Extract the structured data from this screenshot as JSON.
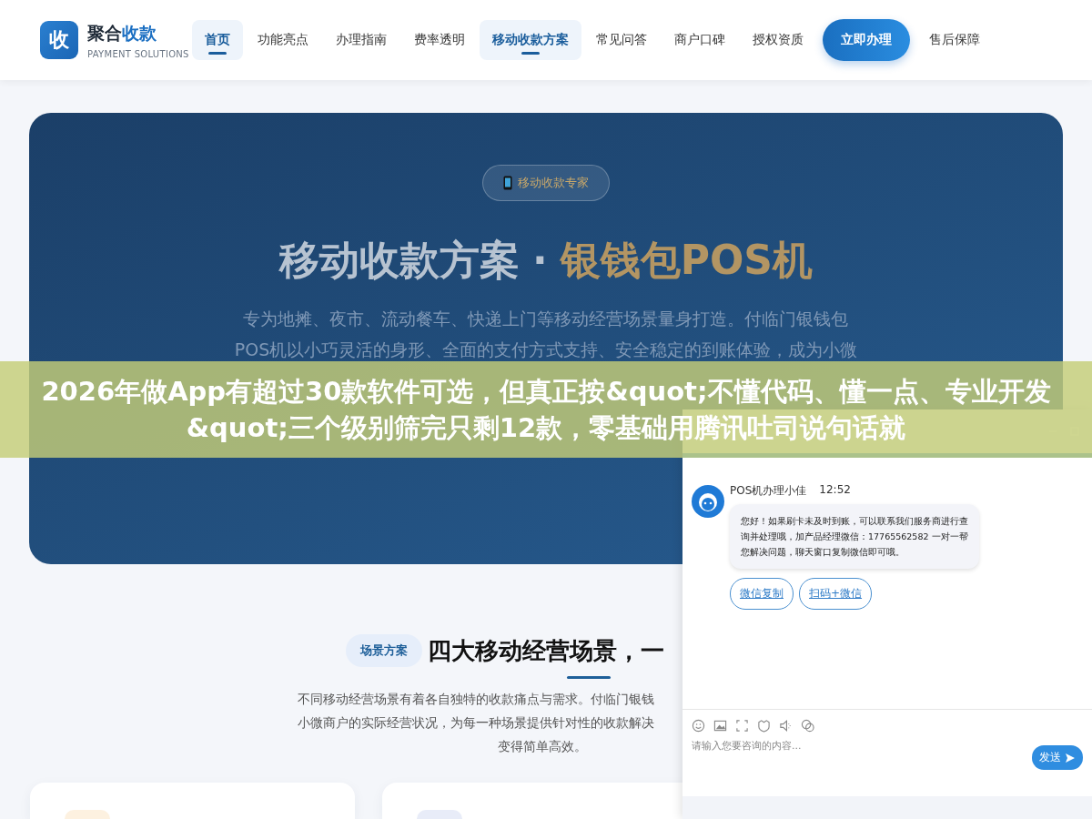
{
  "header": {
    "logo": "收",
    "brand": {
      "name": "聚合",
      "accent": "收款",
      "sub": "PAYMENT SOLUTIONS"
    },
    "nav": [
      {
        "label": "首页",
        "kind": "link",
        "selected": true
      },
      {
        "label": "功能亮点",
        "kind": "link",
        "selected": false
      },
      {
        "label": "办理指南",
        "kind": "link",
        "selected": false
      },
      {
        "label": "费率透明",
        "kind": "link",
        "selected": false
      },
      {
        "label": "移动收款方案",
        "kind": "link",
        "selected": true
      },
      {
        "label": "常见问答",
        "kind": "link",
        "selected": false
      },
      {
        "label": "商户口碑",
        "kind": "link",
        "selected": false
      },
      {
        "label": "授权资质",
        "kind": "link",
        "selected": false
      },
      {
        "label": "立即办理",
        "kind": "cta",
        "selected": false
      },
      {
        "label": "售后保障",
        "kind": "link",
        "selected": false
      }
    ]
  },
  "hero": {
    "badge": "移动收款专家",
    "title": {
      "text": "移动收款方案",
      "separator": "·",
      "accent": "银钱包POS机"
    },
    "lines": [
      "专为地摊、夜市、流动餐车、快递上门等移动经营场景量身打造。付临门银钱包",
      "POS机以小巧灵活的身形、全面的支付方式支持、安全稳定的到账体验，成为小微"
    ]
  },
  "banner": {
    "text": "2026年做App有超过30款软件可选，但真正按&quot;不懂代码、懂一点、专业开发&quot;三个级别筛完只剩12款，零基础用腾讯吐司说句话就"
  },
  "section": {
    "tag": "场景方案",
    "heading": "四大移动经营场景，一",
    "lines": [
      "不同移动经营场景有着各自独特的收款痛点与需求。付临门银钱",
      "小微商户的实际经营状况，为每一种场景提供针对性的收款解决",
      "变得简单高效。"
    ]
  },
  "chat": {
    "agent": "POS机办理小佳",
    "time": "12:52",
    "message": "您好！如果刷卡未及时到账，可以联系我们服务商进行查询并处理哦，加产品经理微信：17765562582 一对一帮您解决问题，聊天窗口复制微信即可哦。",
    "actions": [
      "微信复制",
      "扫码+微信"
    ],
    "input": {
      "placeholder": "请输入您要咨询的内容..."
    },
    "send": "发送"
  }
}
